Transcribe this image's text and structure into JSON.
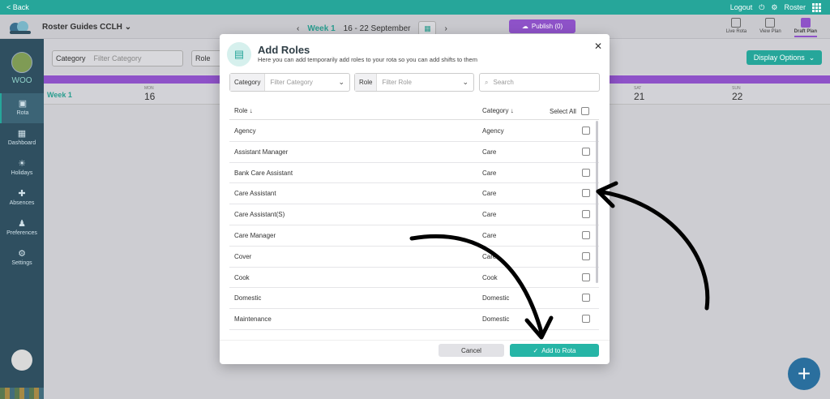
{
  "topbar": {
    "back": "< Back",
    "logout": "Logout",
    "roster": "Roster"
  },
  "header": {
    "org": "Roster Guides CCLH",
    "week_label": "Week 1",
    "week_range": "16 - 22 September",
    "publish": "Publish (0)",
    "views": [
      {
        "label": "Live Rota"
      },
      {
        "label": "View Plan"
      },
      {
        "label": "Draft Plan"
      }
    ]
  },
  "sidebar": {
    "org_short": "WOO",
    "items": [
      {
        "label": "Rota",
        "icon": "calendar-icon"
      },
      {
        "label": "Dashboard",
        "icon": "dashboard-icon"
      },
      {
        "label": "Holidays",
        "icon": "holidays-icon"
      },
      {
        "label": "Absences",
        "icon": "absences-icon"
      },
      {
        "label": "Preferences",
        "icon": "preferences-icon"
      },
      {
        "label": "Settings",
        "icon": "gear-icon"
      }
    ]
  },
  "filters": {
    "category_label": "Category",
    "category_placeholder": "Filter Category",
    "role_label": "Role",
    "display_options": "Display Options"
  },
  "calendar": {
    "week": "Week 1",
    "days": [
      {
        "abbr": "MON",
        "num": "16"
      },
      {
        "abbr": "SAT",
        "num": "21"
      },
      {
        "abbr": "SUN",
        "num": "22"
      }
    ]
  },
  "modal": {
    "title": "Add Roles",
    "subtitle": "Here you can add temporarily add roles to your rota so you can add shifts to them",
    "filter_category_label": "Category",
    "filter_category_placeholder": "Filter Category",
    "filter_role_label": "Role",
    "filter_role_placeholder": "Filter Role",
    "search_placeholder": "Search",
    "col_role": "Role",
    "col_category": "Category",
    "col_select_all": "Select All",
    "rows": [
      {
        "role": "Agency",
        "category": "Agency"
      },
      {
        "role": "Assistant Manager",
        "category": "Care"
      },
      {
        "role": "Bank Care Assistant",
        "category": "Care"
      },
      {
        "role": "Care Assistant",
        "category": "Care"
      },
      {
        "role": "Care Assistant(S)",
        "category": "Care"
      },
      {
        "role": "Care Manager",
        "category": "Care"
      },
      {
        "role": "Cover",
        "category": "Care"
      },
      {
        "role": "Cook",
        "category": "Cook"
      },
      {
        "role": "Domestic",
        "category": "Domestic"
      },
      {
        "role": "Maintenance",
        "category": "Domestic"
      }
    ],
    "cancel": "Cancel",
    "add": "Add to Rota"
  },
  "colors": {
    "teal": "#26a69a",
    "purple": "#8e52c8",
    "sidebar": "#2f4f60"
  }
}
